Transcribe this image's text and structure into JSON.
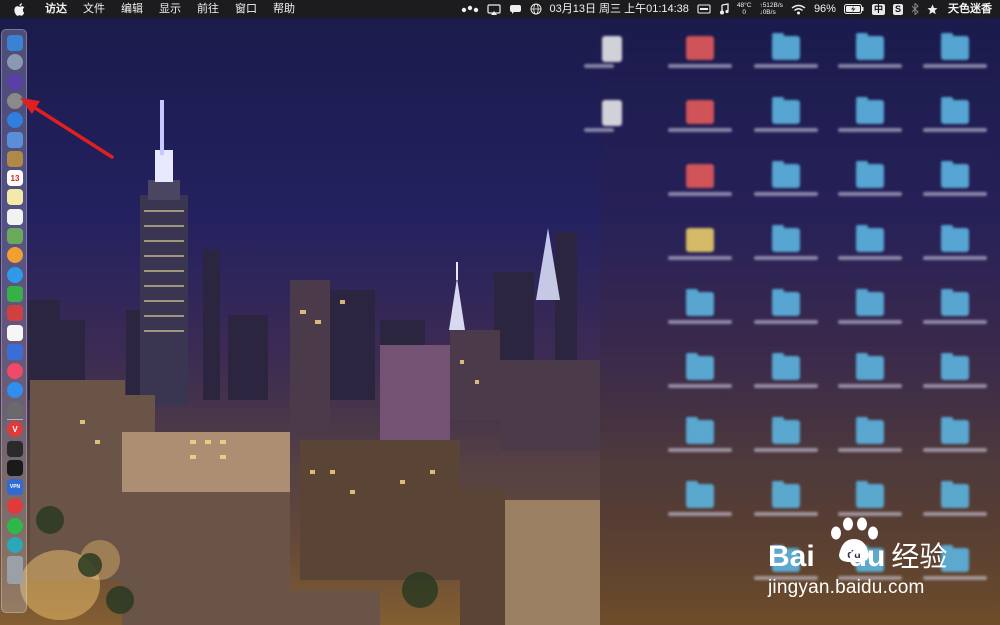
{
  "menubar": {
    "apple_icon": "apple-logo-icon",
    "app_name": "访达",
    "menus": [
      "文件",
      "编辑",
      "显示",
      "前往",
      "窗口",
      "帮助"
    ],
    "status": {
      "temp_top": "48°C",
      "temp_bottom": "0",
      "net_up": "↑512B/s",
      "net_down": "↓0B/s",
      "date_time": "03月13日 周三 上午01:14:38",
      "battery": "96%",
      "input_method": "中",
      "sogou": "S",
      "user": "天色迷香"
    }
  },
  "dock": {
    "items": [
      {
        "name": "finder-icon",
        "color": "#3b82d6",
        "glyph": ""
      },
      {
        "name": "launchpad-icon",
        "color": "#8a98b0",
        "glyph": ""
      },
      {
        "name": "siri-icon",
        "color": "#5b3fa8",
        "glyph": ""
      },
      {
        "name": "system-settings-icon",
        "color": "#8a8a8a",
        "glyph": ""
      },
      {
        "name": "safari-icon",
        "color": "#2f7ee0",
        "glyph": ""
      },
      {
        "name": "preview-icon",
        "color": "#5a8ed6",
        "glyph": ""
      },
      {
        "name": "notes-brown-icon",
        "color": "#b08848",
        "glyph": ""
      },
      {
        "name": "calendar-icon",
        "color": "#ffffff",
        "glyph": "13"
      },
      {
        "name": "notes-icon",
        "color": "#f3e9a8",
        "glyph": ""
      },
      {
        "name": "reminders-icon",
        "color": "#f2f2f2",
        "glyph": ""
      },
      {
        "name": "photos-edit-icon",
        "color": "#6aa85a",
        "glyph": ""
      },
      {
        "name": "photos-icon",
        "color": "#f0a030",
        "glyph": ""
      },
      {
        "name": "messages-icon",
        "color": "#2f9ae8",
        "glyph": ""
      },
      {
        "name": "facetime-icon",
        "color": "#38b048",
        "glyph": ""
      },
      {
        "name": "photo-booth-icon",
        "color": "#d04040",
        "glyph": ""
      },
      {
        "name": "numbers-icon",
        "color": "#f6f6f6",
        "glyph": ""
      },
      {
        "name": "keynote-icon",
        "color": "#3a6ed6",
        "glyph": ""
      },
      {
        "name": "music-icon",
        "color": "#f04a6a",
        "glyph": ""
      },
      {
        "name": "app-store-icon",
        "color": "#2f8ef0",
        "glyph": ""
      },
      {
        "name": "time-machine-icon",
        "color": "#6a6a6a",
        "glyph": ""
      },
      {
        "name": "vivaldi-icon",
        "color": "#e03a3a",
        "glyph": "V"
      },
      {
        "name": "activity-monitor-icon",
        "color": "#2a2a2a",
        "glyph": ""
      },
      {
        "name": "terminal-icon",
        "color": "#1a1a1a",
        "glyph": ""
      },
      {
        "name": "vpn-icon",
        "color": "#2f6ad6",
        "glyph": "VPN"
      },
      {
        "name": "netease-music-icon",
        "color": "#e23a3a",
        "glyph": ""
      },
      {
        "name": "wechat-icon",
        "color": "#2fb84a",
        "glyph": ""
      },
      {
        "name": "teal-app-icon",
        "color": "#2aa8b8",
        "glyph": ""
      },
      {
        "name": "trash-icon",
        "color": "#9aa0a8",
        "glyph": ""
      }
    ]
  },
  "watermark": {
    "logo_prefix": "Bai",
    "logo_suffix": "du",
    "logo_cn": "经验",
    "url": "jingyan.baidu.com"
  }
}
